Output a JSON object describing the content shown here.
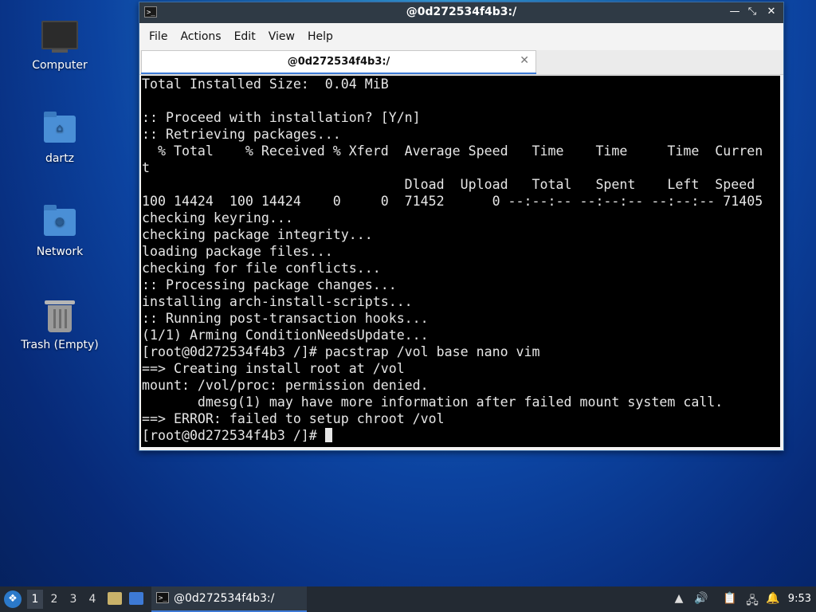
{
  "desktop": {
    "icons": [
      {
        "label": "Computer"
      },
      {
        "label": "dartz"
      },
      {
        "label": "Network"
      },
      {
        "label": "Trash (Empty)"
      }
    ]
  },
  "window": {
    "title": "@0d272534f4b3:/",
    "menu": [
      "File",
      "Actions",
      "Edit",
      "View",
      "Help"
    ],
    "tab_label": "@0d272534f4b3:/",
    "terminal_lines": [
      "Total Installed Size:  0.04 MiB",
      "",
      ":: Proceed with installation? [Y/n]",
      ":: Retrieving packages...",
      "  % Total    % Received % Xferd  Average Speed   Time    Time     Time  Curren",
      "t",
      "                                 Dload  Upload   Total   Spent    Left  Speed",
      "100 14424  100 14424    0     0  71452      0 --:--:-- --:--:-- --:--:-- 71405",
      "checking keyring...",
      "checking package integrity...",
      "loading package files...",
      "checking for file conflicts...",
      ":: Processing package changes...",
      "installing arch-install-scripts...",
      ":: Running post-transaction hooks...",
      "(1/1) Arming ConditionNeedsUpdate...",
      "[root@0d272534f4b3 /]# pacstrap /vol base nano vim",
      "==> Creating install root at /vol",
      "mount: /vol/proc: permission denied.",
      "       dmesg(1) may have more information after failed mount system call.",
      "==> ERROR: failed to setup chroot /vol"
    ],
    "prompt": "[root@0d272534f4b3 /]# "
  },
  "taskbar": {
    "workspaces": [
      "1",
      "2",
      "3",
      "4"
    ],
    "task_label": "@0d272534f4b3:/",
    "clock": "9:53"
  }
}
